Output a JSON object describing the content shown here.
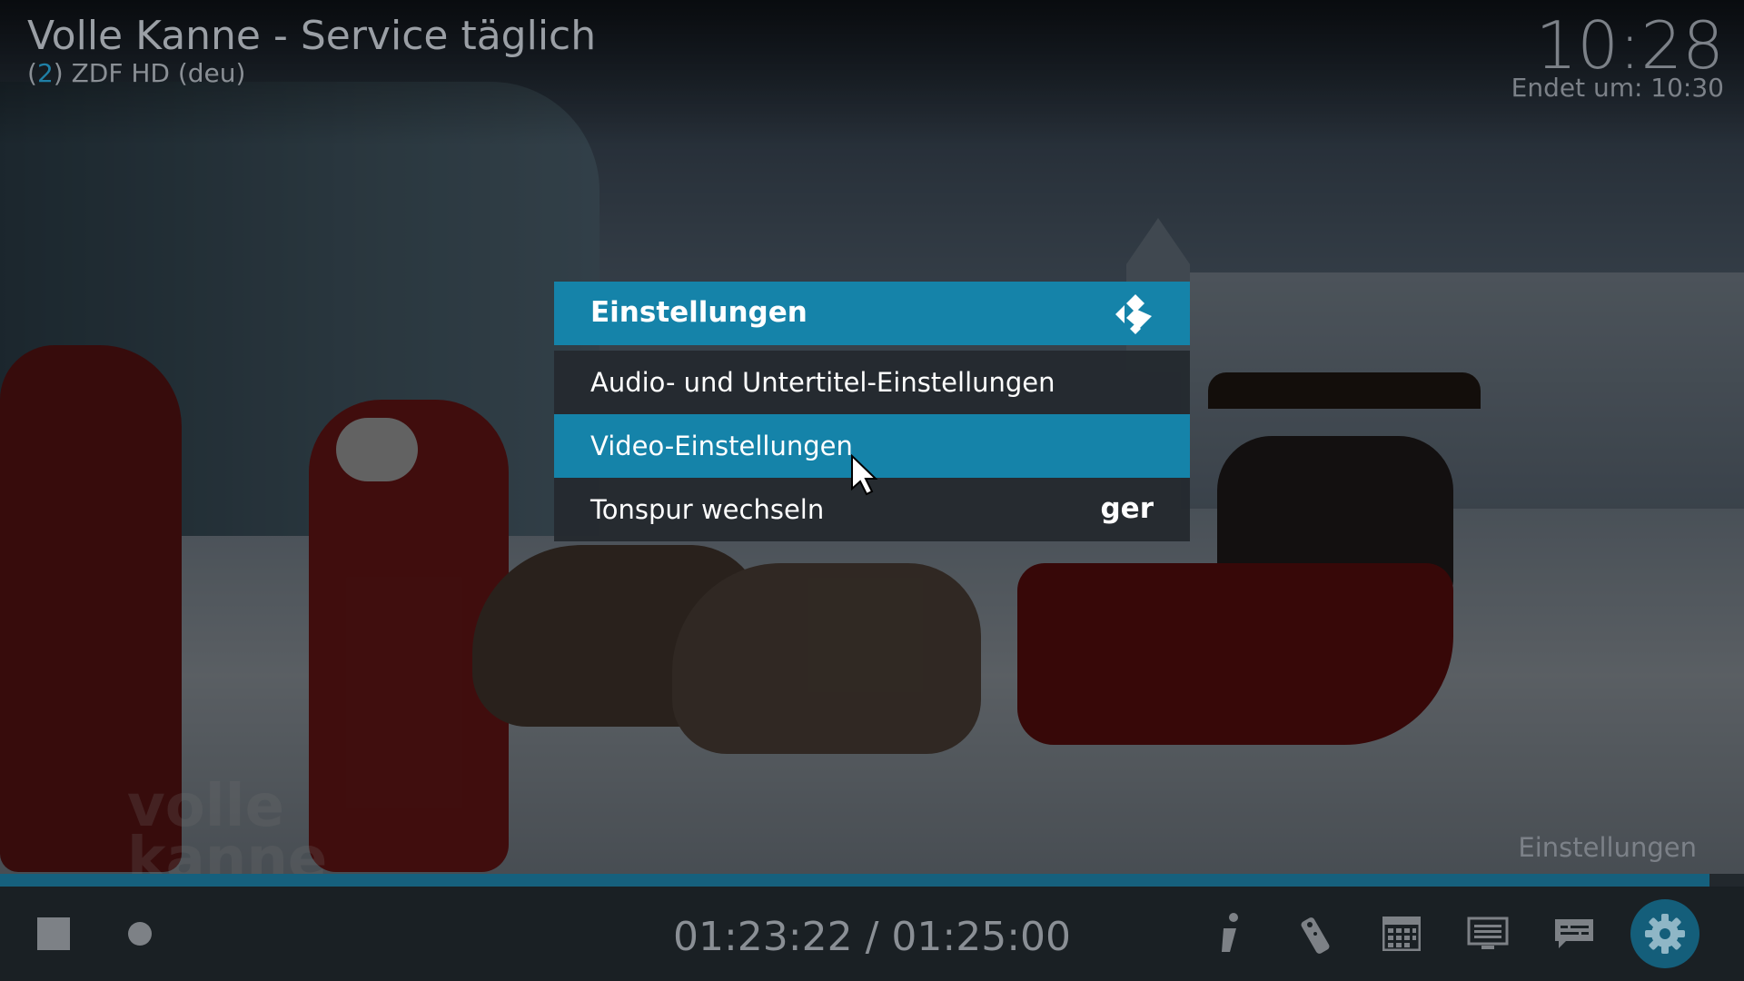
{
  "header": {
    "title": "Volle Kanne - Service täglich",
    "channel_number": "2",
    "channel_name": "ZDF HD (deu)",
    "clock": "10:28",
    "ends_at": "Endet um: 10:30"
  },
  "dialog": {
    "title": "Einstellungen",
    "items": [
      {
        "label": "Audio- und Untertitel-Einstellungen",
        "value": ""
      },
      {
        "label": "Video-Einstellungen",
        "value": ""
      },
      {
        "label": "Tonspur wechseln",
        "value": "ger"
      }
    ]
  },
  "osd": {
    "active_label": "Einstellungen",
    "time_display": "01:23:22 / 01:25:00",
    "progress": 0.98
  },
  "watermark": [
    "volle",
    "kanne"
  ],
  "icons": {
    "buttons": [
      "stop-icon",
      "record-icon",
      "info-icon",
      "remote-icon",
      "guide-icon",
      "teletext-icon",
      "subtitles-icon",
      "settings-icon"
    ]
  },
  "colors": {
    "accent": "#1583a9",
    "progress": "#16607d"
  }
}
